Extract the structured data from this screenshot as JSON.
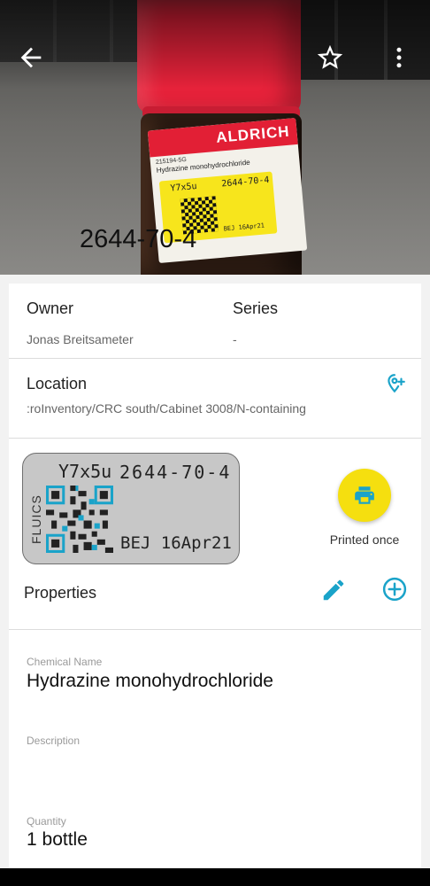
{
  "hero": {
    "caption": "2644-70-4",
    "bottle_label": {
      "brand": "ALDRICH",
      "catalog": "215194-5G",
      "name": "Hydrazine monohydrochloride",
      "tag_code": "Y7x5u",
      "tag_cas": "2644-70-4",
      "tag_date": "BEJ 16Apr21"
    }
  },
  "toolbar": {
    "back_icon": "arrow-left-icon",
    "favorite_icon": "star-outline-icon",
    "more_icon": "more-vertical-icon"
  },
  "owner": {
    "title": "Owner",
    "value": "Jonas Breitsameter"
  },
  "series": {
    "title": "Series",
    "value": "-"
  },
  "location": {
    "title": "Location",
    "value": ":roInventory/CRC south/Cabinet 3008/N-containing",
    "icon": "location-add-icon"
  },
  "print_label": {
    "brand": "FLUICS",
    "code": "Y7x5u",
    "cas": "2644-70-4",
    "date": "BEJ 16Apr21",
    "status": "Printed once",
    "button_icon": "printer-icon"
  },
  "properties": {
    "title": "Properties",
    "edit_icon": "pencil-icon",
    "add_icon": "plus-circle-icon"
  },
  "fields": [
    {
      "label": "Chemical Name",
      "value": "Hydrazine monohydrochloride"
    },
    {
      "label": "Description",
      "value": ""
    },
    {
      "label": "Quantity",
      "value": "1 bottle"
    }
  ],
  "colors": {
    "accent": "#1aa3c9",
    "print_button": "#f5df0f",
    "tag_background": "#c7c7c7"
  }
}
